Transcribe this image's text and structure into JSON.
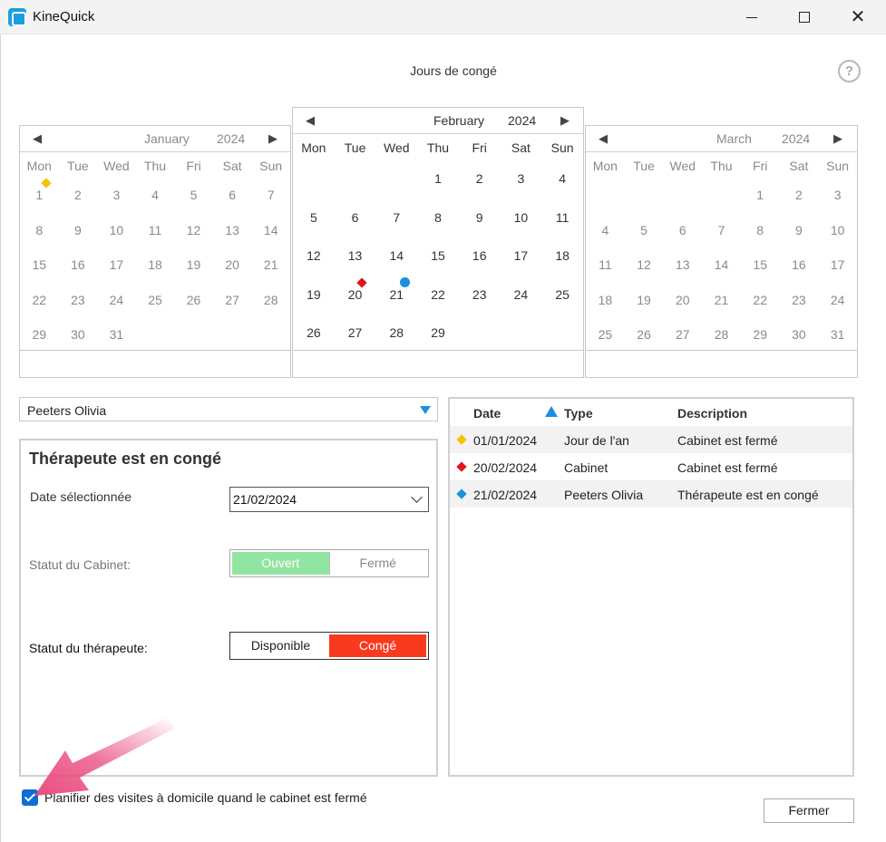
{
  "window": {
    "title": "KineQuick",
    "heading": "Jours de congé",
    "help": "?",
    "close_glyph": "✕"
  },
  "calendars": [
    {
      "month": "January",
      "year": "2024",
      "weekdays": [
        "Mon",
        "Tue",
        "Wed",
        "Thu",
        "Fri",
        "Sat",
        "Sun"
      ],
      "weeks": [
        [
          "1",
          "2",
          "3",
          "4",
          "5",
          "6",
          "7"
        ],
        [
          "8",
          "9",
          "10",
          "11",
          "12",
          "13",
          "14"
        ],
        [
          "15",
          "16",
          "17",
          "18",
          "19",
          "20",
          "21"
        ],
        [
          "22",
          "23",
          "24",
          "25",
          "26",
          "27",
          "28"
        ],
        [
          "29",
          "30",
          "31",
          "",
          "",
          "",
          ""
        ]
      ],
      "markers": [
        {
          "day": "1",
          "shape": "diamond",
          "color": "#f5c400"
        }
      ]
    },
    {
      "month": "February",
      "year": "2024",
      "weekdays": [
        "Mon",
        "Tue",
        "Wed",
        "Thu",
        "Fri",
        "Sat",
        "Sun"
      ],
      "weeks": [
        [
          "",
          "",
          "",
          "1",
          "2",
          "3",
          "4"
        ],
        [
          "5",
          "6",
          "7",
          "8",
          "9",
          "10",
          "11"
        ],
        [
          "12",
          "13",
          "14",
          "15",
          "16",
          "17",
          "18"
        ],
        [
          "19",
          "20",
          "21",
          "22",
          "23",
          "24",
          "25"
        ],
        [
          "26",
          "27",
          "28",
          "29",
          "",
          "",
          ""
        ]
      ],
      "markers": [
        {
          "day": "20",
          "shape": "diamond",
          "color": "#e0161b"
        },
        {
          "day": "21",
          "shape": "dot",
          "color": "#1a8fe0"
        }
      ]
    },
    {
      "month": "March",
      "year": "2024",
      "weekdays": [
        "Mon",
        "Tue",
        "Wed",
        "Thu",
        "Fri",
        "Sat",
        "Sun"
      ],
      "weeks": [
        [
          "",
          "",
          "",
          "",
          "1",
          "2",
          "3"
        ],
        [
          "4",
          "5",
          "6",
          "7",
          "8",
          "9",
          "10"
        ],
        [
          "11",
          "12",
          "13",
          "14",
          "15",
          "16",
          "17"
        ],
        [
          "18",
          "19",
          "20",
          "21",
          "22",
          "23",
          "24"
        ],
        [
          "25",
          "26",
          "27",
          "28",
          "29",
          "30",
          "31"
        ]
      ],
      "markers": []
    }
  ],
  "therapist_select": {
    "value": "Peeters Olivia"
  },
  "detail": {
    "title": "Thérapeute est en congé",
    "date_label": "Date sélectionnée",
    "date_value": "21/02/2024",
    "cabinet_label": "Statut du Cabinet:",
    "cabinet_options": {
      "open": "Ouvert",
      "closed": "Fermé"
    },
    "cabinet_selected": "Ouvert",
    "therapist_label": "Statut du thérapeute:",
    "therapist_options": {
      "available": "Disponible",
      "leave": "Congé"
    },
    "therapist_selected": "Congé"
  },
  "holiday_list": {
    "headers": {
      "date": "Date",
      "type": "Type",
      "description": "Description"
    },
    "sort": "date ascending",
    "rows": [
      {
        "date": "01/01/2024",
        "type": "Jour de l'an",
        "description": "Cabinet est fermé",
        "marker_color": "#f5c400"
      },
      {
        "date": "20/02/2024",
        "type": "Cabinet",
        "description": "Cabinet est fermé",
        "marker_color": "#e0161b"
      },
      {
        "date": "21/02/2024",
        "type": "Peeters Olivia",
        "description": "Thérapeute est en congé",
        "marker_color": "#1a8fe0"
      }
    ]
  },
  "home_visits": {
    "label": "Planifier des visites à domicile quand le cabinet est fermé",
    "checked": true
  },
  "close_button": {
    "label": "Fermer"
  },
  "colors": {
    "accent": "#1a8fe0",
    "open_green": "#92e5a1",
    "leave_red": "#f93a1f",
    "annotation_pink": "#e9457a"
  }
}
